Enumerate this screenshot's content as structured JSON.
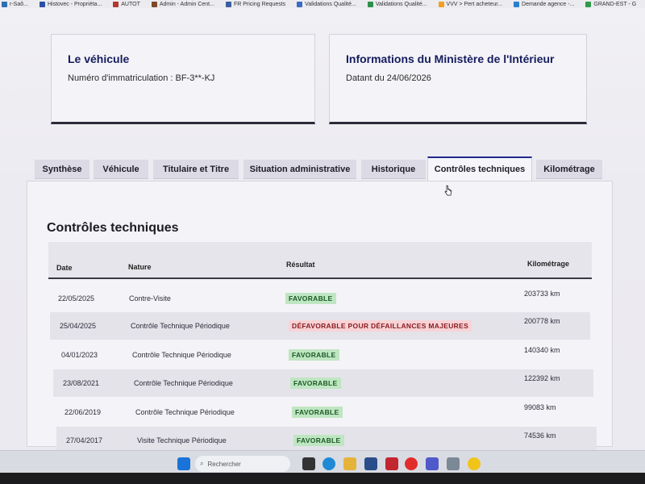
{
  "bookmarks": [
    {
      "label": "r-Saô...",
      "color": "#2f6fb1"
    },
    {
      "label": "Histovec - Propriéta...",
      "color": "#2b4fa6"
    },
    {
      "label": "AUTOT",
      "color": "#b03a2e"
    },
    {
      "label": "Admin - Admin Cent...",
      "color": "#7a4a2a"
    },
    {
      "label": "FR Pricing Requests",
      "color": "#3a5fa0"
    },
    {
      "label": "Validations Qualité...",
      "color": "#3b6cc4"
    },
    {
      "label": "Validations Qualité...",
      "color": "#2f8f4a"
    },
    {
      "label": "VVV > Pert acheteur...",
      "color": "#f0a020"
    },
    {
      "label": "Demande agence -...",
      "color": "#2a7fd0"
    },
    {
      "label": "GRAND-EST - G",
      "color": "#2f9a4a"
    }
  ],
  "vehicle_card": {
    "title": "Le véhicule",
    "plate": "Numéro d'immatriculation : BF-3**-KJ"
  },
  "ministry_card": {
    "title": "Informations du Ministère de l'Intérieur",
    "date": "Datant du 24/06/2026"
  },
  "tabs": [
    {
      "label": "Synthèse"
    },
    {
      "label": "Véhicule"
    },
    {
      "label": "Titulaire et Titre"
    },
    {
      "label": "Situation administrative"
    },
    {
      "label": "Historique"
    },
    {
      "label": "Contrôles techniques",
      "active": true
    },
    {
      "label": "Kilométrage"
    }
  ],
  "section": {
    "title": "Contrôles techniques",
    "columns": {
      "date": "Date",
      "nature": "Nature",
      "result": "Résultat",
      "km": "Kilométrage"
    },
    "rows": [
      {
        "date": "22/05/2025",
        "nature": "Contre-Visite",
        "result": "FAVORABLE",
        "status": "ok",
        "km": "203733 km"
      },
      {
        "date": "25/04/2025",
        "nature": "Contrôle Technique Périodique",
        "result": "DÉFAVORABLE POUR DÉFAILLANCES MAJEURES",
        "status": "ko",
        "km": "200778 km"
      },
      {
        "date": "04/01/2023",
        "nature": "Contrôle Technique Périodique",
        "result": "FAVORABLE",
        "status": "ok",
        "km": "140340 km"
      },
      {
        "date": "23/08/2021",
        "nature": "Contrôle Technique Périodique",
        "result": "FAVORABLE",
        "status": "ok",
        "km": "122392 km"
      },
      {
        "date": "22/06/2019",
        "nature": "Contrôle Technique Périodique",
        "result": "FAVORABLE",
        "status": "ok",
        "km": "99083 km"
      },
      {
        "date": "27/04/2017",
        "nature": "Visite Technique Périodique",
        "result": "FAVORABLE",
        "status": "ok",
        "km": "74536 km"
      }
    ]
  },
  "taskbar": {
    "search_placeholder": "Rechercher",
    "icons": [
      "windows-start-icon",
      "task-view-icon",
      "edge-icon",
      "file-explorer-icon",
      "store-icon",
      "notification-app-icon",
      "opera-icon",
      "teams-icon",
      "outlook-icon",
      "chrome-icon"
    ]
  }
}
